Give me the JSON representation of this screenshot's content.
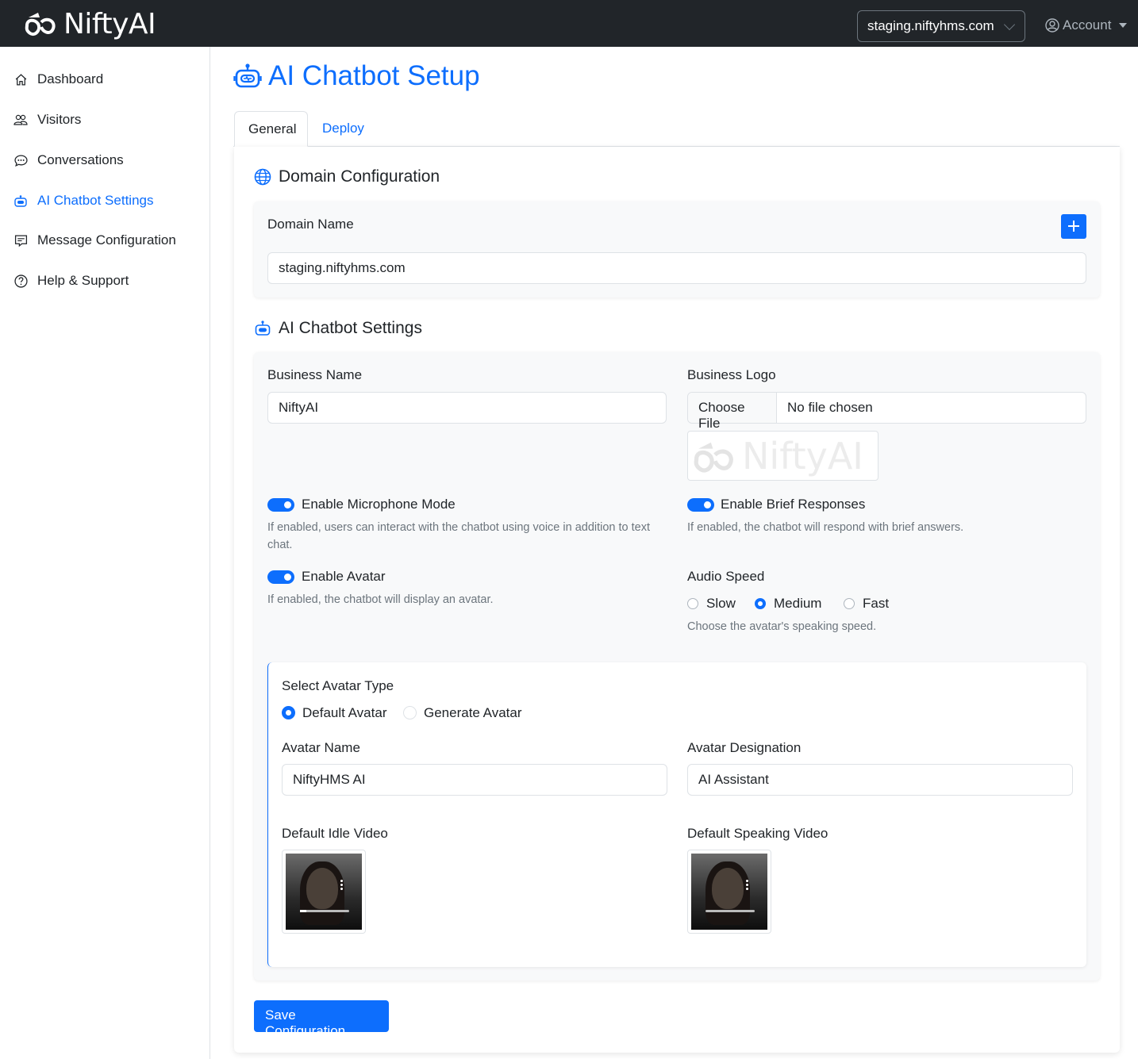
{
  "brand": {
    "name": "NiftyAI"
  },
  "header": {
    "domain_select": "staging.niftyhms.com",
    "account_label": "Account"
  },
  "sidebar": {
    "items": [
      {
        "label": "Dashboard",
        "icon": "home-icon"
      },
      {
        "label": "Visitors",
        "icon": "people-icon"
      },
      {
        "label": "Conversations",
        "icon": "chat-dots-icon"
      },
      {
        "label": "AI Chatbot Settings",
        "icon": "robot-icon",
        "active": true
      },
      {
        "label": "Message Configuration",
        "icon": "chat-square-text-icon"
      },
      {
        "label": "Help & Support",
        "icon": "question-circle-icon"
      }
    ]
  },
  "page": {
    "title": "AI Chatbot Setup",
    "tabs": [
      {
        "label": "General",
        "active": true
      },
      {
        "label": "Deploy",
        "active": false
      }
    ]
  },
  "domain_config": {
    "title": "Domain Configuration",
    "domain_name_label": "Domain Name",
    "domain_value": "staging.niftyhms.com"
  },
  "chatbot_settings": {
    "title": "AI Chatbot Settings",
    "business_name_label": "Business Name",
    "business_name_value": "NiftyAI",
    "business_logo_label": "Business Logo",
    "choose_file_label": "Choose File",
    "no_file_label": "No file chosen",
    "logo_preview_text": "NiftyAI",
    "microphone": {
      "label": "Enable Microphone Mode",
      "enabled": true,
      "help": "If enabled, users can interact with the chatbot using voice in addition to text chat."
    },
    "brief": {
      "label": "Enable Brief Responses",
      "enabled": true,
      "help": "If enabled, the chatbot will respond with brief answers."
    },
    "avatar": {
      "label": "Enable Avatar",
      "enabled": true,
      "help": "If enabled, the chatbot will display an avatar."
    },
    "audio_speed": {
      "label": "Audio Speed",
      "options": [
        "Slow",
        "Medium",
        "Fast"
      ],
      "selected": "Medium",
      "help": "Choose the avatar's speaking speed."
    }
  },
  "avatar_section": {
    "type_label": "Select Avatar Type",
    "type_options": [
      "Default Avatar",
      "Generate Avatar"
    ],
    "type_selected": "Default Avatar",
    "name_label": "Avatar Name",
    "name_value": "NiftyHMS AI",
    "designation_label": "Avatar Designation",
    "designation_value": "AI Assistant",
    "idle_video_label": "Default Idle Video",
    "speaking_video_label": "Default Speaking Video"
  },
  "actions": {
    "save_label": "Save Configuration"
  },
  "colors": {
    "primary": "#0d6efd",
    "navbar": "#212529",
    "muted": "#6c757d"
  }
}
